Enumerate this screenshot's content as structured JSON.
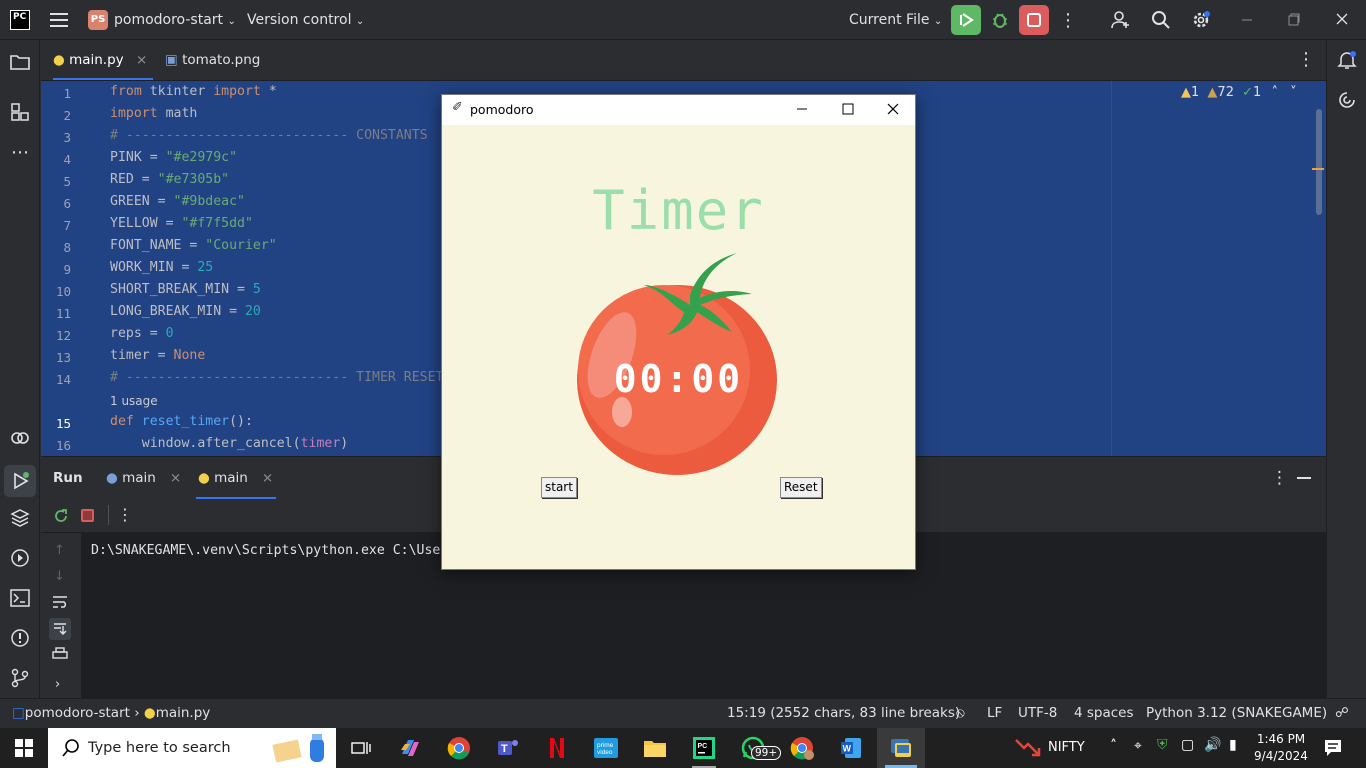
{
  "ide": {
    "logo": "PC",
    "project_badge": "PS",
    "project_name": "pomodoro-start",
    "vcs_label": "Version control",
    "run_config": "Current File",
    "tabs": [
      {
        "label": "main.py",
        "icon": "python-file-icon"
      },
      {
        "label": "tomato.png",
        "icon": "image-file-icon"
      }
    ],
    "inspections": {
      "warnings_a": "1",
      "warnings_b": "72",
      "checks": "1"
    }
  },
  "editor": {
    "lines": [
      {
        "n": "1"
      },
      {
        "n": "2"
      },
      {
        "n": "3"
      },
      {
        "n": "4"
      },
      {
        "n": "5"
      },
      {
        "n": "6"
      },
      {
        "n": "7"
      },
      {
        "n": "8"
      },
      {
        "n": "9"
      },
      {
        "n": "10"
      },
      {
        "n": "11"
      },
      {
        "n": "12"
      },
      {
        "n": "13"
      },
      {
        "n": "14"
      },
      {
        "n": "15"
      },
      {
        "n": "16"
      }
    ],
    "code": {
      "l1_kw1": "from",
      "l1_mod": " tkinter ",
      "l1_kw2": "import",
      "l1_star": " *",
      "l2_kw": "import",
      "l2_mod": " math",
      "l3": "# ---------------------------- CONSTANTS",
      "l4_name": "PINK = ",
      "l4_val": "\"#e2979c\"",
      "l5_name": "RED = ",
      "l5_val": "\"#e7305b\"",
      "l6_name": "GREEN = ",
      "l6_val": "\"#9bdeac\"",
      "l7_name": "YELLOW = ",
      "l7_val": "\"#f7f5dd\"",
      "l8_name": "FONT_NAME = ",
      "l8_val": "\"Courier\"",
      "l9_name": "WORK_MIN = ",
      "l9_val": "25",
      "l10_name": "SHORT_BREAK_MIN = ",
      "l10_val": "5",
      "l11_name": "LONG_BREAK_MIN = ",
      "l11_val": "20",
      "l12_name": "reps = ",
      "l12_val": "0",
      "l13_name": "timer = ",
      "l13_val": "None",
      "l14": "# ---------------------------- TIMER RESET",
      "usage": "1 usage",
      "l15_kw": "def",
      "l15_fn": " reset_timer",
      "l15_rest": "():",
      "l16_pre": "    window.after_cancel(",
      "l16_arg": "timer",
      "l16_post": ")"
    }
  },
  "run": {
    "title": "Run",
    "tabs": [
      {
        "label": "main"
      },
      {
        "label": "main"
      }
    ],
    "console_line": "D:\\SNAKEGAME\\.venv\\Scripts\\python.exe C:\\Use"
  },
  "status": {
    "breadcrumb_project": "pomodoro-start",
    "breadcrumb_file": "main.py",
    "position": "15:19 (2552 chars, 83 line breaks)",
    "line_sep": "LF",
    "encoding": "UTF-8",
    "indent": "4 spaces",
    "interpreter": "Python 3.12 (SNAKEGAME)"
  },
  "tk_window": {
    "title": "pomodoro",
    "timer_label": "Timer",
    "countdown": "00:00",
    "start_label": "start",
    "reset_label": "Reset",
    "colors": {
      "bg": "#f7f5dd",
      "green": "#9bdeac",
      "tomato": "#f05a3c"
    }
  },
  "taskbar": {
    "search_placeholder": "Type here to search",
    "whatsapp_badge": "99+",
    "nifty_label": "NIFTY",
    "time": "1:46 PM",
    "date": "9/4/2024"
  }
}
